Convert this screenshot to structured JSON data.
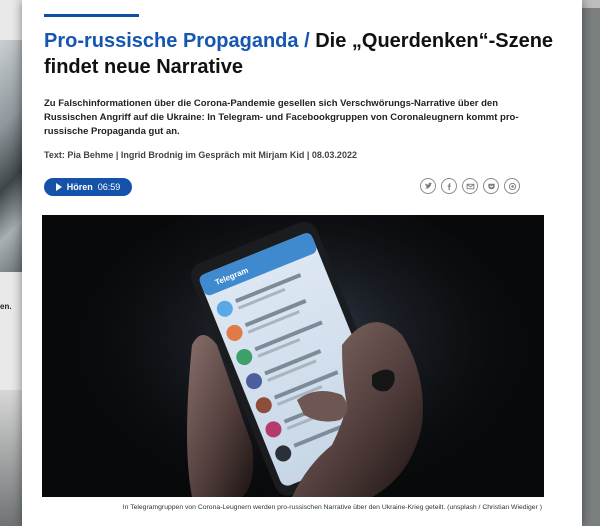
{
  "background": {
    "caption_fragment": "en."
  },
  "article": {
    "kicker": "Pro-russische Propaganda / ",
    "headline": "Die „Querdenken“-Szene findet neue Narrative",
    "lead": "Zu Falschinformationen über die Corona-Pandemie gesellen sich Verschwörungs-Narrative über den Russischen Angriff auf die Ukraine: In Telegram- und Facebookgruppen von Coronaleugnern kommt pro-russische Propaganda gut an.",
    "meta": "Text: Pia Behme | Ingrid Brodnig im Gespräch mit Mirjam Kid | 08.03.2022",
    "listen_label": "Hören",
    "listen_duration": "06:59",
    "share_icons": [
      "twitter-icon",
      "facebook-icon",
      "email-icon",
      "pocket-icon",
      "share-icon"
    ],
    "image_caption": "In Telegramgruppen von Corona-Leugnern werden pro-russischen Narrative über den Ukraine-Krieg geteilt. (unsplash / Christian Wiediger )",
    "phone_app_title": "Telegram"
  },
  "colors": {
    "accent": "#1456b0",
    "button": "#1553aa"
  }
}
